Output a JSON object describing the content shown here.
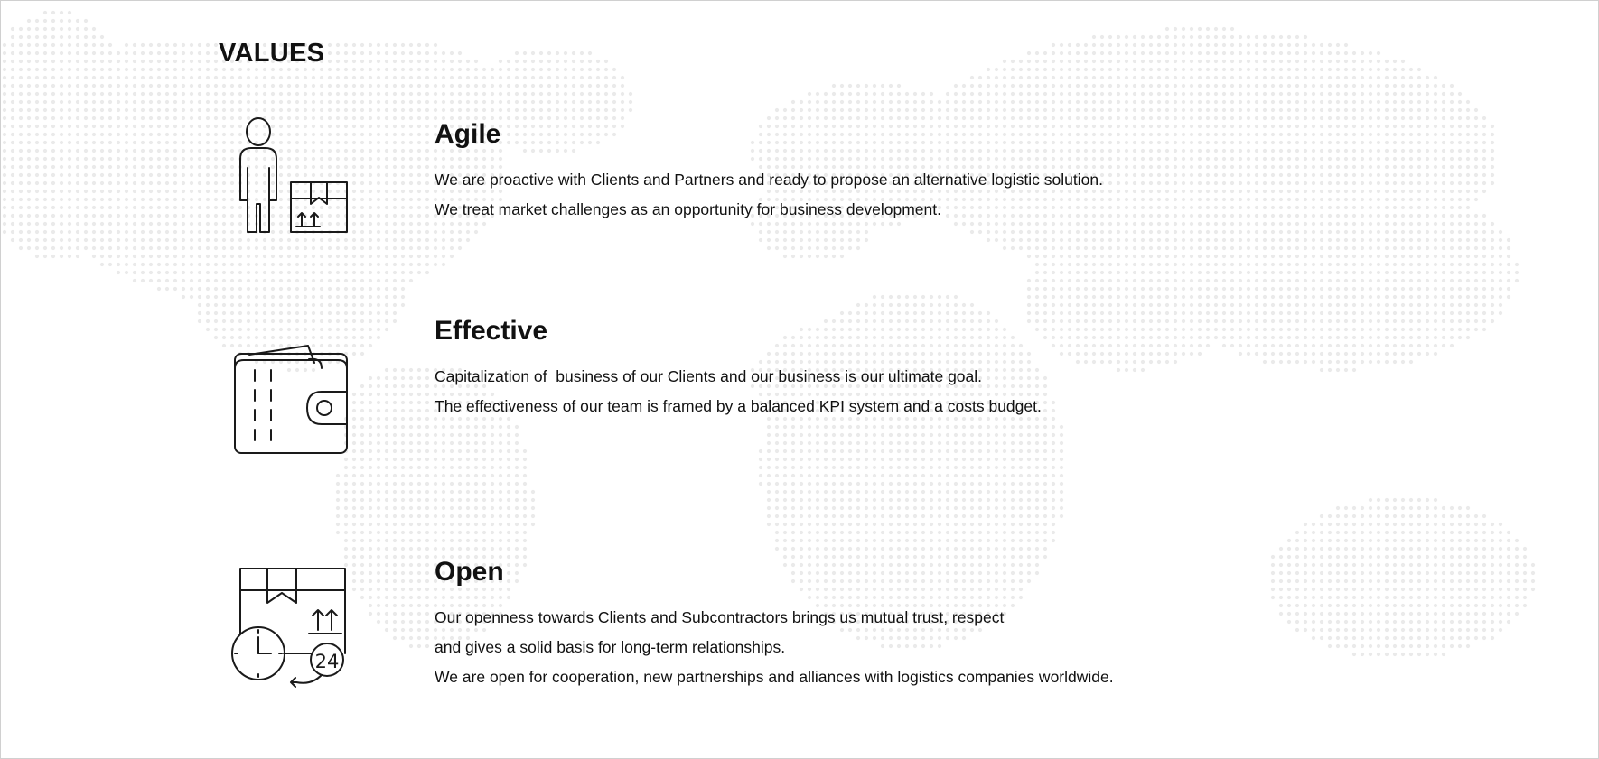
{
  "page": {
    "title": "VALUES"
  },
  "values": [
    {
      "icon": "person-with-box-icon",
      "heading": "Agile",
      "lines": [
        "We are proactive with Clients and Partners and ready to propose an alternative logistic solution.",
        "We treat market challenges as an opportunity for business development."
      ]
    },
    {
      "icon": "wallet-icon",
      "heading": "Effective",
      "lines": [
        "Capitalization of  business of our Clients and our business is our ultimate goal.",
        "The effectiveness of our team is framed by a balanced KPI system and a costs budget."
      ]
    },
    {
      "icon": "box-clock-24-icon",
      "heading": "Open",
      "lines": [
        "Our openness towards Clients and Subcontractors brings us mutual trust, respect",
        "and gives a solid basis for long-term relationships.",
        "We are open for cooperation, new partnerships and alliances with logistics companies worldwide."
      ],
      "badge": "24"
    }
  ],
  "colors": {
    "background": "#ffffff",
    "text": "#111111",
    "map_dots": "#eaeaea",
    "icon_stroke": "#1a1a1a"
  }
}
